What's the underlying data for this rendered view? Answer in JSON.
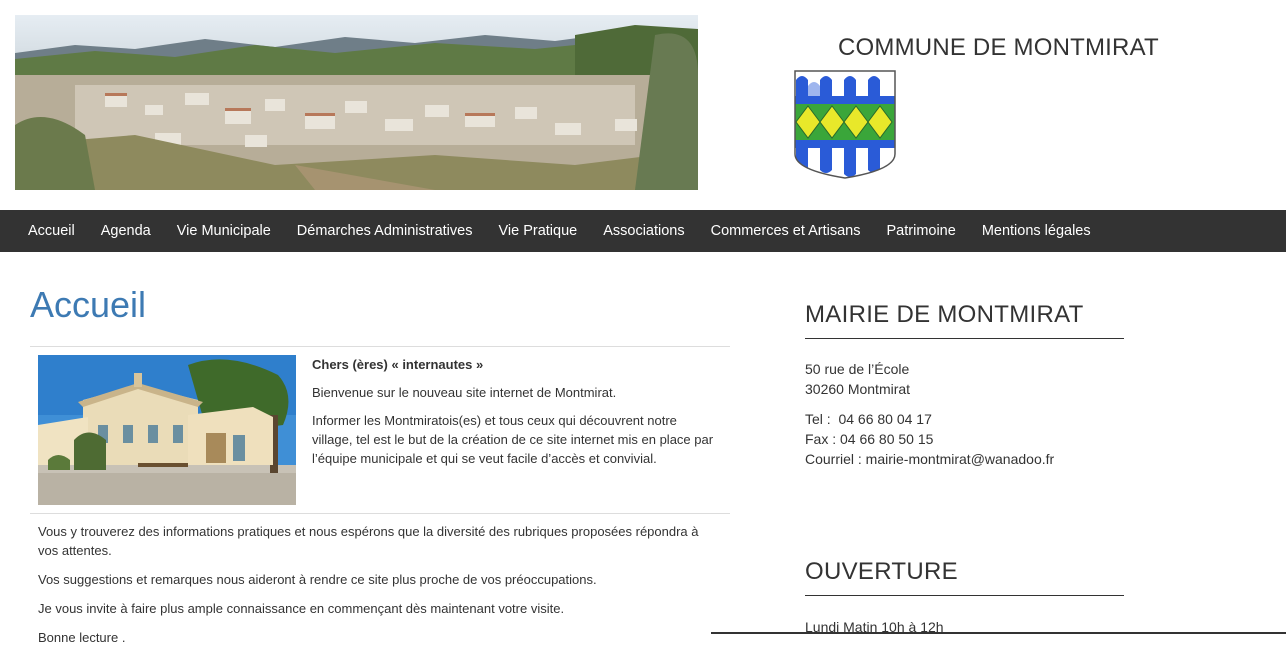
{
  "header": {
    "site_title": "COMMUNE DE MONTMIRAT",
    "banner_alt": "village panorama",
    "crest_alt": "Blason de Montmirat"
  },
  "nav": {
    "items": [
      "Accueil",
      "Agenda",
      "Vie Municipale",
      "Démarches Administratives",
      "Vie Pratique",
      "Associations",
      "Commerces et Artisans",
      "Patrimoine",
      "Mentions légales"
    ]
  },
  "main": {
    "page_title": "Accueil",
    "greeting": "Chers (ères) « internautes »",
    "welcome": "Bienvenue sur le nouveau site internet de Montmirat.",
    "purpose": "Informer les Montmiratois(es) et tous ceux qui découvrent notre village, tel est le but de la création de ce site internet mis en place par l’équipe municipale et qui se veut facile d’accès et convivial.",
    "para1": "Vous y trouverez des informations pratiques et nous espérons que la diversité des rubriques proposées répondra à vos attentes.",
    "para2": "Vos suggestions et remarques nous aideront à rendre ce site plus proche de vos préoccupations.",
    "para3": "Je vous invite à faire plus ample connaissance en commençant dès maintenant votre visite.",
    "para4": "Bonne lecture ."
  },
  "sidebar": {
    "mairie_heading": "MAIRIE DE MONTMIRAT",
    "address_line1": "50 rue de l’École",
    "address_line2": "30260 Montmirat",
    "tel": "Tel :  04 66 80 04 17",
    "fax": "Fax : 04 66 80 50 15",
    "email": "Courriel : mairie-montmirat@wanadoo.fr",
    "hours_heading": "OUVERTURE",
    "hours_line1": "Lundi Matin 10h à 12h"
  },
  "colors": {
    "nav_bg": "#333333",
    "title_blue": "#3d7ab3",
    "crest_blue": "#2a5bd7",
    "crest_green": "#3aa63a",
    "crest_yellow": "#e8e82a"
  }
}
